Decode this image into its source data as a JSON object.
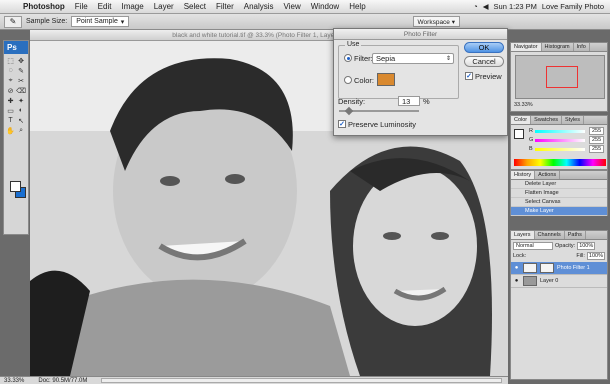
{
  "menubar": {
    "apple": "",
    "app_name": "Photoshop",
    "items": [
      "File",
      "Edit",
      "Image",
      "Layer",
      "Select",
      "Filter",
      "Analysis",
      "View",
      "Window",
      "Help"
    ],
    "clock": "Sun 1:23 PM",
    "user": "Love Family Photo"
  },
  "options_bar": {
    "sample_size_label": "Sample Size:",
    "sample_size_value": "Point Sample",
    "workspace_label": "Workspace ▾"
  },
  "toolbar": {
    "logo": "Ps",
    "tools": [
      "⬚",
      "✥",
      "◌",
      "✎",
      "⌖",
      "✂",
      "⊘",
      "⌫",
      "✚",
      "✦",
      "▭",
      "◐",
      "T",
      "↖",
      "✋",
      "⌕"
    ]
  },
  "document": {
    "title": "black and white tutorial.tif @ 33.3% (Photo Filter 1, Layer Mask/8) *"
  },
  "status_bar": {
    "zoom": "33.33%",
    "doc_size": "Doc: 90.5M/77.0M"
  },
  "photo_filter_dialog": {
    "title": "Photo Filter",
    "use_label": "Use",
    "filter_label": "Filter:",
    "filter_value": "Sepia",
    "color_label": "Color:",
    "color_swatch": "#d9892f",
    "density_label": "Density:",
    "density_value": "13",
    "density_unit": "%",
    "density_level_percent": 13,
    "preserve_label": "Preserve Luminosity",
    "ok_label": "OK",
    "cancel_label": "Cancel",
    "preview_label": "Preview",
    "check_mark": "✓"
  },
  "panels": {
    "navigator_tabs": [
      "Navigator",
      "Histogram",
      "Info"
    ],
    "navigator_zoom": "33.33%",
    "color_tabs": [
      "Color",
      "Swatches",
      "Styles"
    ],
    "color_channels": [
      {
        "label": "R",
        "value": "255"
      },
      {
        "label": "G",
        "value": "255"
      },
      {
        "label": "B",
        "value": "255"
      }
    ],
    "history_tabs": [
      "History",
      "Actions"
    ],
    "history_items": [
      "Delete Layer",
      "Flatten Image",
      "Select Canvas",
      "Make Layer"
    ],
    "layers_tabs": [
      "Layers",
      "Channels",
      "Paths"
    ],
    "blend_mode": "Normal",
    "opacity_label": "Opacity:",
    "opacity_value": "100%",
    "lock_label": "Lock:",
    "fill_label": "Fill:",
    "fill_value": "100%",
    "layers": [
      {
        "name": "Photo Filter 1",
        "eye": "●",
        "selected": true
      },
      {
        "name": "Layer 0",
        "eye": "●",
        "selected": false
      }
    ]
  }
}
